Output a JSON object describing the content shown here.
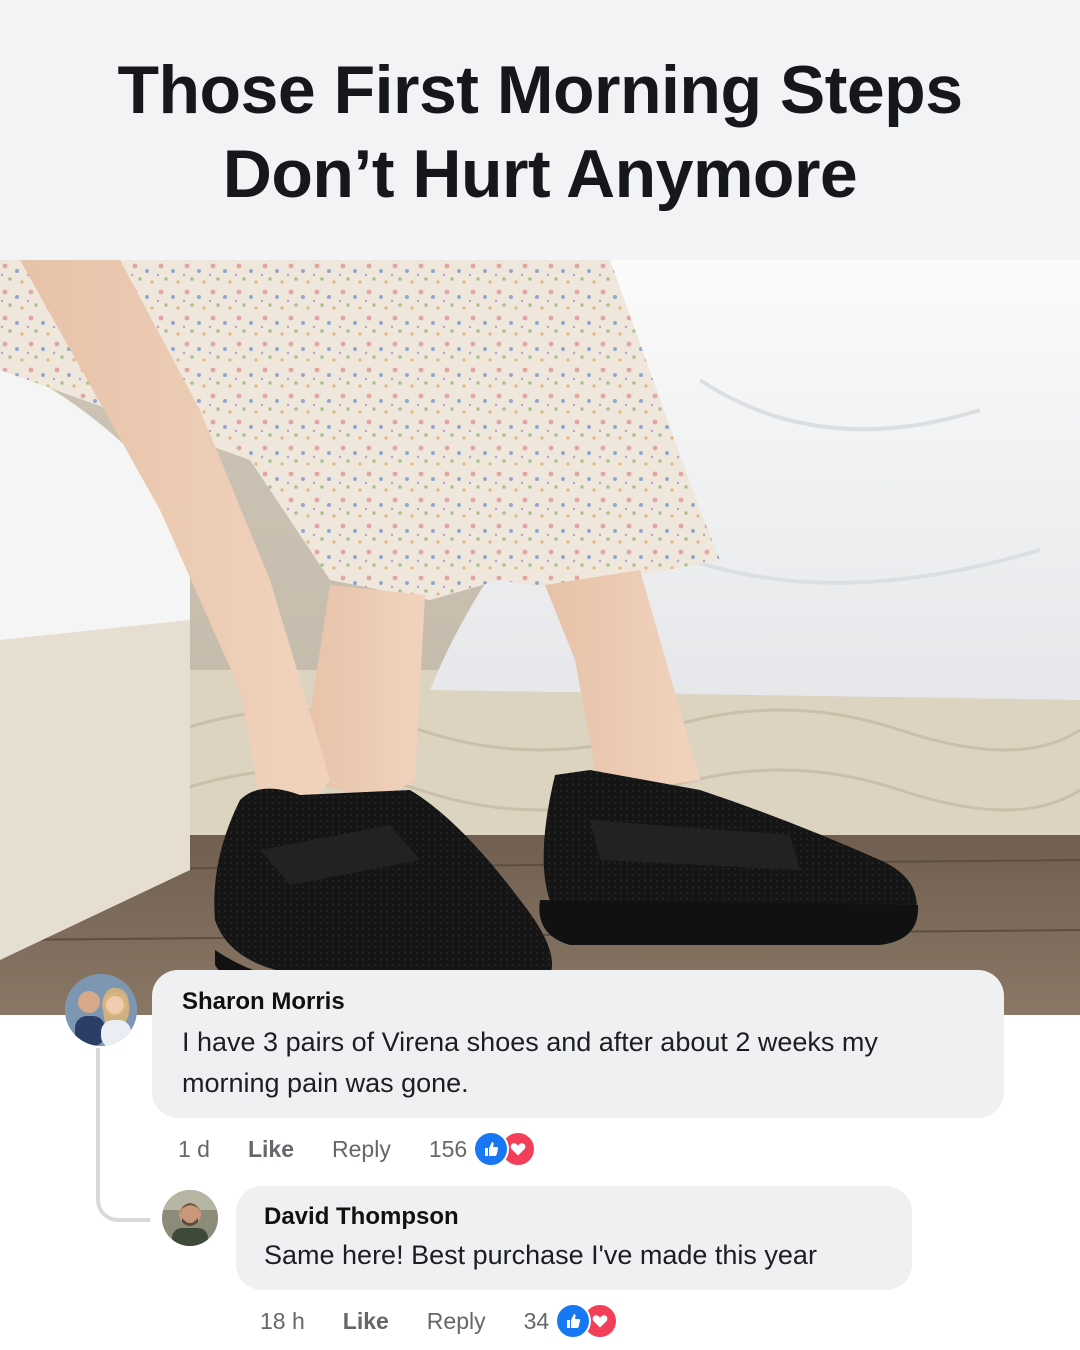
{
  "headline": {
    "line1": "Those First Morning Steps",
    "line2": "Don’t Hurt Anymore"
  },
  "comments": [
    {
      "author": "Sharon Morris",
      "text_line1": "I have 3 pairs of Virena shoes and after about 2 weeks my",
      "text_line2": "morning pain was gone.",
      "time": "1 d",
      "like_label": "Like",
      "reply_label": "Reply",
      "reaction_count": "156"
    },
    {
      "author": "David Thompson",
      "text": "Same here! Best purchase I've made this year",
      "time": "18 h",
      "like_label": "Like",
      "reply_label": "Reply",
      "reaction_count": "34"
    }
  ],
  "colors": {
    "like_blue": "#1877f2",
    "love_red": "#f33e58",
    "bubble_gray": "#eef0f2"
  },
  "icons": [
    "like-reaction-icon",
    "love-reaction-icon"
  ]
}
